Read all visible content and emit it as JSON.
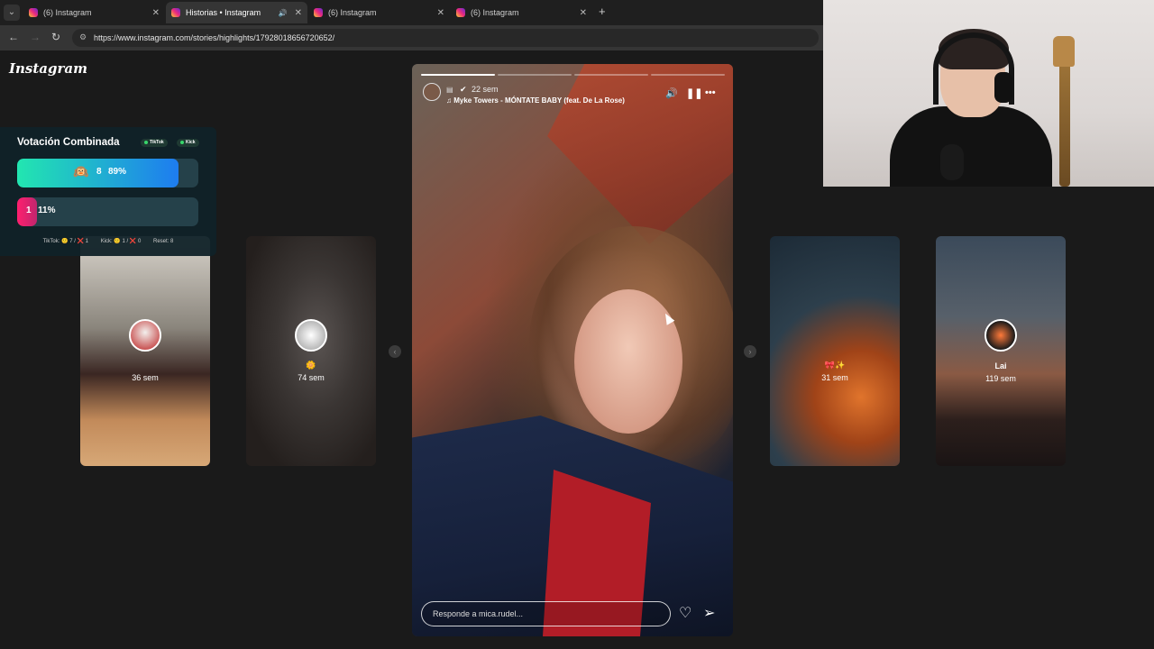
{
  "browser": {
    "tabs": [
      {
        "title": "(6) Instagram",
        "active": false
      },
      {
        "title": "Historias • Instagram",
        "active": true,
        "audio": true
      },
      {
        "title": "(6) Instagram",
        "active": false
      },
      {
        "title": "(6) Instagram",
        "active": false
      }
    ],
    "url": "https://www.instagram.com/stories/highlights/17928018656720652/"
  },
  "instagram": {
    "logo": "Instagram",
    "story": {
      "time_ago": "22 sem",
      "music": "Myke Towers - MÓNTATE BABY (feat. De La Rose)",
      "reply_placeholder": "Responde a mica.rudel...",
      "segments_total": 4,
      "segments_done": 1,
      "icons": [
        "volume-icon",
        "pause-icon",
        "more-icon",
        "heart-icon",
        "send-icon"
      ]
    },
    "side_stories": [
      {
        "time": "36 sem"
      },
      {
        "time": "74 sem"
      },
      {
        "time": "31 sem"
      },
      {
        "name": "Lai",
        "time": "119 sem"
      }
    ]
  },
  "vote_widget": {
    "title": "Votación Combinada",
    "pills": [
      "TikTok",
      "Kick"
    ],
    "option_a": {
      "count": "8",
      "percent": "89%",
      "value": 0.89
    },
    "option_b": {
      "count": "1",
      "percent": "11%",
      "value": 0.11
    },
    "stats": {
      "tiktok": "TikTok: 🙂 7 / ❌ 1",
      "kick": "Kick: 🙂 1 / ❌ 0",
      "reset": "Reset: 8"
    },
    "colors": {
      "a_start": "#22e6b0",
      "a_end": "#1e7cf0",
      "b_start": "#ff1f6e",
      "b_end": "#c0266e"
    }
  }
}
